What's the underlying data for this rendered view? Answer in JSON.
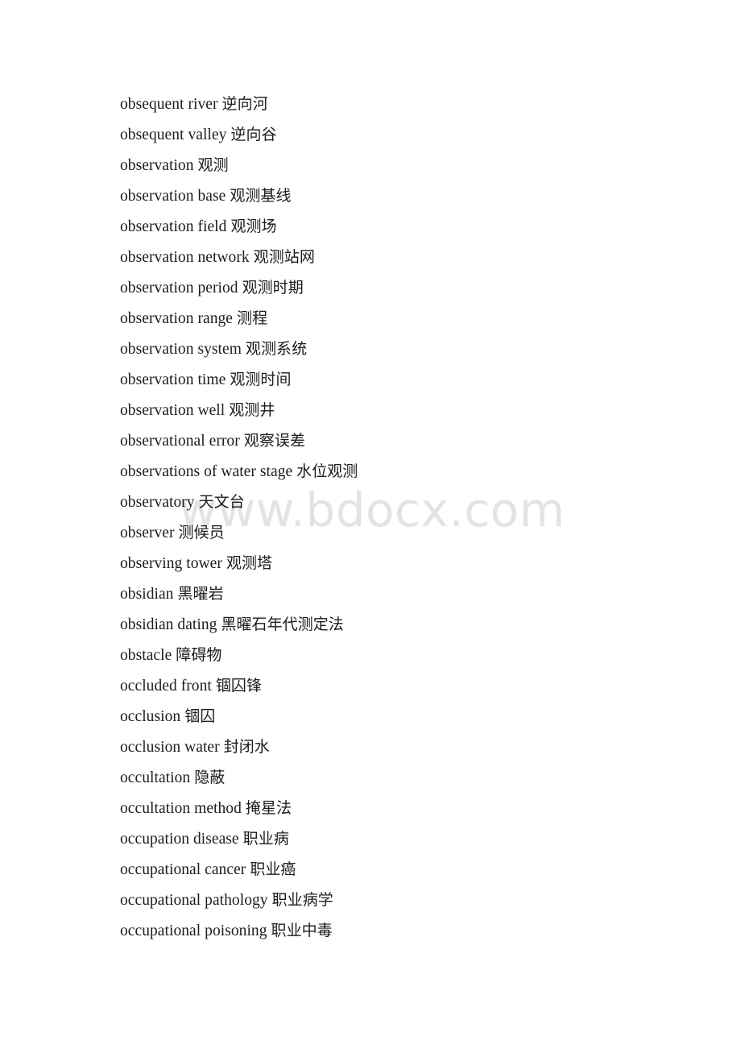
{
  "page": {
    "background_color": "#ffffff",
    "text_color": "#1c1c1c"
  },
  "watermark": {
    "text": "www.bdocx.com",
    "color": "#e3e3e3"
  },
  "glossary": {
    "entries": [
      {
        "term": "obsequent river",
        "gloss": "逆向河"
      },
      {
        "term": "obsequent valley",
        "gloss": "逆向谷"
      },
      {
        "term": "observation",
        "gloss": "观测"
      },
      {
        "term": "observation base",
        "gloss": "观测基线"
      },
      {
        "term": "observation field",
        "gloss": "观测场"
      },
      {
        "term": "observation network",
        "gloss": "观测站网"
      },
      {
        "term": "observation period",
        "gloss": "观测时期"
      },
      {
        "term": "observation range",
        "gloss": "测程"
      },
      {
        "term": "observation system",
        "gloss": "观测系统"
      },
      {
        "term": "observation time",
        "gloss": "观测时间"
      },
      {
        "term": "observation well",
        "gloss": "观测井"
      },
      {
        "term": "observational error",
        "gloss": "观察误差"
      },
      {
        "term": "observations of water stage",
        "gloss": "水位观测"
      },
      {
        "term": "observatory",
        "gloss": "天文台"
      },
      {
        "term": "observer",
        "gloss": "测候员"
      },
      {
        "term": "observing tower",
        "gloss": "观测塔"
      },
      {
        "term": "obsidian",
        "gloss": "黑曜岩"
      },
      {
        "term": "obsidian dating",
        "gloss": "黑曜石年代测定法"
      },
      {
        "term": "obstacle",
        "gloss": "障碍物"
      },
      {
        "term": "occluded front",
        "gloss": "锢囚锋"
      },
      {
        "term": "occlusion",
        "gloss": "锢囚"
      },
      {
        "term": "occlusion water",
        "gloss": "封闭水"
      },
      {
        "term": "occultation",
        "gloss": "隐蔽"
      },
      {
        "term": "occultation method",
        "gloss": "掩星法"
      },
      {
        "term": "occupation disease",
        "gloss": "职业病"
      },
      {
        "term": "occupational cancer",
        "gloss": "职业癌"
      },
      {
        "term": "occupational pathology",
        "gloss": "职业病学"
      },
      {
        "term": "occupational poisoning",
        "gloss": "职业中毒"
      }
    ]
  }
}
